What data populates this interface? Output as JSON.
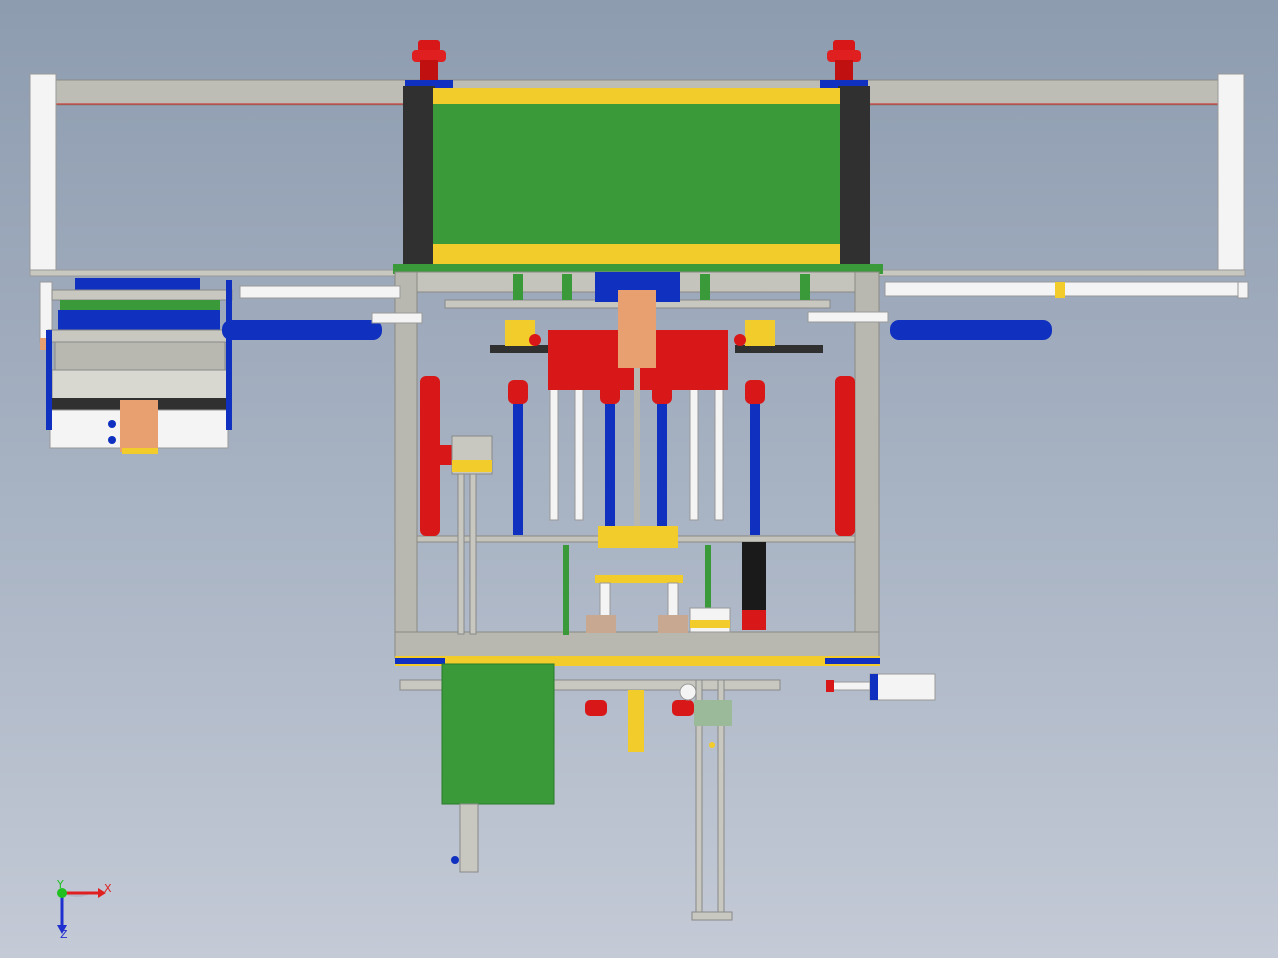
{
  "viewport": {
    "background_top": "#8e9cb0",
    "background_bottom": "#c4cad6"
  },
  "triad": {
    "x_label": "X",
    "y_label": "Y",
    "z_label": "Z",
    "x_color": "#e02020",
    "y_color": "#20c020",
    "z_color": "#2030d0"
  },
  "palette": {
    "frame_gray": "#b8b8b0",
    "plate_green": "#3a9a3a",
    "accent_yellow": "#f2cc2a",
    "cylinder_blue": "#1030c0",
    "cylinder_red": "#d81818",
    "rod_white": "#f4f4f4",
    "dark_gray": "#333333",
    "copper": "#e8a070"
  }
}
